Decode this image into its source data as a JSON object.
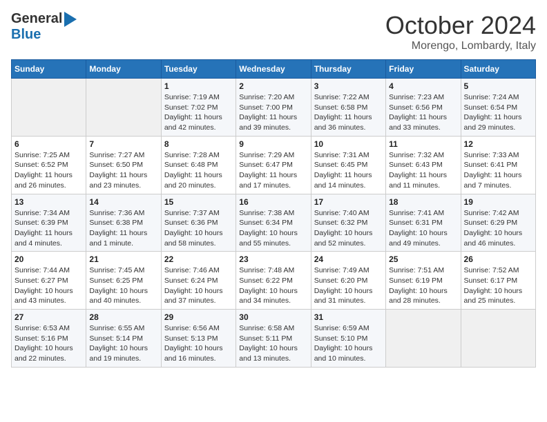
{
  "logo": {
    "general": "General",
    "blue": "Blue"
  },
  "header": {
    "month": "October 2024",
    "location": "Morengo, Lombardy, Italy"
  },
  "weekdays": [
    "Sunday",
    "Monday",
    "Tuesday",
    "Wednesday",
    "Thursday",
    "Friday",
    "Saturday"
  ],
  "weeks": [
    [
      {
        "day": "",
        "info": ""
      },
      {
        "day": "",
        "info": ""
      },
      {
        "day": "1",
        "info": "Sunrise: 7:19 AM\nSunset: 7:02 PM\nDaylight: 11 hours\nand 42 minutes."
      },
      {
        "day": "2",
        "info": "Sunrise: 7:20 AM\nSunset: 7:00 PM\nDaylight: 11 hours\nand 39 minutes."
      },
      {
        "day": "3",
        "info": "Sunrise: 7:22 AM\nSunset: 6:58 PM\nDaylight: 11 hours\nand 36 minutes."
      },
      {
        "day": "4",
        "info": "Sunrise: 7:23 AM\nSunset: 6:56 PM\nDaylight: 11 hours\nand 33 minutes."
      },
      {
        "day": "5",
        "info": "Sunrise: 7:24 AM\nSunset: 6:54 PM\nDaylight: 11 hours\nand 29 minutes."
      }
    ],
    [
      {
        "day": "6",
        "info": "Sunrise: 7:25 AM\nSunset: 6:52 PM\nDaylight: 11 hours\nand 26 minutes."
      },
      {
        "day": "7",
        "info": "Sunrise: 7:27 AM\nSunset: 6:50 PM\nDaylight: 11 hours\nand 23 minutes."
      },
      {
        "day": "8",
        "info": "Sunrise: 7:28 AM\nSunset: 6:48 PM\nDaylight: 11 hours\nand 20 minutes."
      },
      {
        "day": "9",
        "info": "Sunrise: 7:29 AM\nSunset: 6:47 PM\nDaylight: 11 hours\nand 17 minutes."
      },
      {
        "day": "10",
        "info": "Sunrise: 7:31 AM\nSunset: 6:45 PM\nDaylight: 11 hours\nand 14 minutes."
      },
      {
        "day": "11",
        "info": "Sunrise: 7:32 AM\nSunset: 6:43 PM\nDaylight: 11 hours\nand 11 minutes."
      },
      {
        "day": "12",
        "info": "Sunrise: 7:33 AM\nSunset: 6:41 PM\nDaylight: 11 hours\nand 7 minutes."
      }
    ],
    [
      {
        "day": "13",
        "info": "Sunrise: 7:34 AM\nSunset: 6:39 PM\nDaylight: 11 hours\nand 4 minutes."
      },
      {
        "day": "14",
        "info": "Sunrise: 7:36 AM\nSunset: 6:38 PM\nDaylight: 11 hours\nand 1 minute."
      },
      {
        "day": "15",
        "info": "Sunrise: 7:37 AM\nSunset: 6:36 PM\nDaylight: 10 hours\nand 58 minutes."
      },
      {
        "day": "16",
        "info": "Sunrise: 7:38 AM\nSunset: 6:34 PM\nDaylight: 10 hours\nand 55 minutes."
      },
      {
        "day": "17",
        "info": "Sunrise: 7:40 AM\nSunset: 6:32 PM\nDaylight: 10 hours\nand 52 minutes."
      },
      {
        "day": "18",
        "info": "Sunrise: 7:41 AM\nSunset: 6:31 PM\nDaylight: 10 hours\nand 49 minutes."
      },
      {
        "day": "19",
        "info": "Sunrise: 7:42 AM\nSunset: 6:29 PM\nDaylight: 10 hours\nand 46 minutes."
      }
    ],
    [
      {
        "day": "20",
        "info": "Sunrise: 7:44 AM\nSunset: 6:27 PM\nDaylight: 10 hours\nand 43 minutes."
      },
      {
        "day": "21",
        "info": "Sunrise: 7:45 AM\nSunset: 6:25 PM\nDaylight: 10 hours\nand 40 minutes."
      },
      {
        "day": "22",
        "info": "Sunrise: 7:46 AM\nSunset: 6:24 PM\nDaylight: 10 hours\nand 37 minutes."
      },
      {
        "day": "23",
        "info": "Sunrise: 7:48 AM\nSunset: 6:22 PM\nDaylight: 10 hours\nand 34 minutes."
      },
      {
        "day": "24",
        "info": "Sunrise: 7:49 AM\nSunset: 6:20 PM\nDaylight: 10 hours\nand 31 minutes."
      },
      {
        "day": "25",
        "info": "Sunrise: 7:51 AM\nSunset: 6:19 PM\nDaylight: 10 hours\nand 28 minutes."
      },
      {
        "day": "26",
        "info": "Sunrise: 7:52 AM\nSunset: 6:17 PM\nDaylight: 10 hours\nand 25 minutes."
      }
    ],
    [
      {
        "day": "27",
        "info": "Sunrise: 6:53 AM\nSunset: 5:16 PM\nDaylight: 10 hours\nand 22 minutes."
      },
      {
        "day": "28",
        "info": "Sunrise: 6:55 AM\nSunset: 5:14 PM\nDaylight: 10 hours\nand 19 minutes."
      },
      {
        "day": "29",
        "info": "Sunrise: 6:56 AM\nSunset: 5:13 PM\nDaylight: 10 hours\nand 16 minutes."
      },
      {
        "day": "30",
        "info": "Sunrise: 6:58 AM\nSunset: 5:11 PM\nDaylight: 10 hours\nand 13 minutes."
      },
      {
        "day": "31",
        "info": "Sunrise: 6:59 AM\nSunset: 5:10 PM\nDaylight: 10 hours\nand 10 minutes."
      },
      {
        "day": "",
        "info": ""
      },
      {
        "day": "",
        "info": ""
      }
    ]
  ]
}
